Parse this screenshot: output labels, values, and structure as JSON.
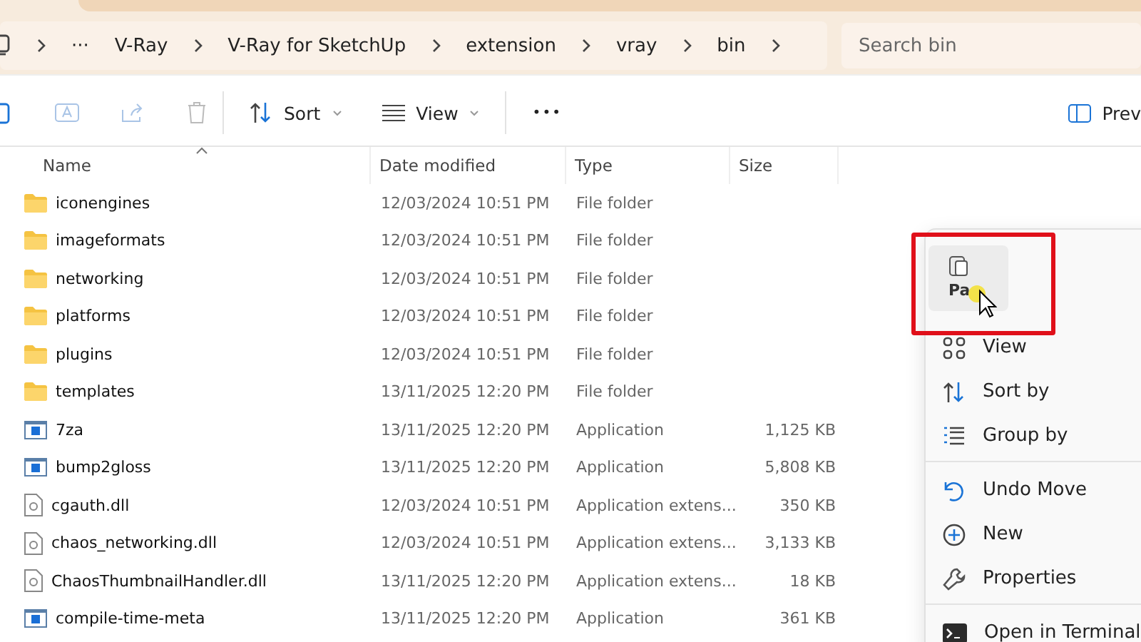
{
  "breadcrumb": {
    "overflow": "···",
    "segments": [
      "V-Ray",
      "V-Ray for SketchUp",
      "extension",
      "vray",
      "bin"
    ]
  },
  "search": {
    "placeholder": "Search bin"
  },
  "toolbar": {
    "sort": "Sort",
    "view": "View",
    "more": "•••",
    "preview": "Prev"
  },
  "columns": [
    "Name",
    "Date modified",
    "Type",
    "Size"
  ],
  "rows": [
    {
      "kind": "folder",
      "name": "iconengines",
      "date": "12/03/2024 10:51 PM",
      "type": "File folder",
      "size": ""
    },
    {
      "kind": "folder",
      "name": "imageformats",
      "date": "12/03/2024 10:51 PM",
      "type": "File folder",
      "size": ""
    },
    {
      "kind": "folder",
      "name": "networking",
      "date": "12/03/2024 10:51 PM",
      "type": "File folder",
      "size": ""
    },
    {
      "kind": "folder",
      "name": "platforms",
      "date": "12/03/2024 10:51 PM",
      "type": "File folder",
      "size": ""
    },
    {
      "kind": "folder",
      "name": "plugins",
      "date": "12/03/2024 10:51 PM",
      "type": "File folder",
      "size": ""
    },
    {
      "kind": "folder",
      "name": "templates",
      "date": "13/11/2025 12:20 PM",
      "type": "File folder",
      "size": ""
    },
    {
      "kind": "app",
      "name": "7za",
      "date": "13/11/2025 12:20 PM",
      "type": "Application",
      "size": "1,125 KB"
    },
    {
      "kind": "app",
      "name": "bump2gloss",
      "date": "13/11/2025 12:20 PM",
      "type": "Application",
      "size": "5,808 KB"
    },
    {
      "kind": "dll",
      "name": "cgauth.dll",
      "date": "12/03/2024 10:51 PM",
      "type": "Application extens...",
      "size": "350 KB"
    },
    {
      "kind": "dll",
      "name": "chaos_networking.dll",
      "date": "12/03/2024 10:51 PM",
      "type": "Application extens...",
      "size": "3,133 KB"
    },
    {
      "kind": "dll",
      "name": "ChaosThumbnailHandler.dll",
      "date": "13/11/2025 12:20 PM",
      "type": "Application extens...",
      "size": "18 KB"
    },
    {
      "kind": "app",
      "name": "compile-time-meta",
      "date": "13/11/2025 12:20 PM",
      "type": "Application",
      "size": "361 KB"
    }
  ],
  "context_menu": {
    "paste": "Pa",
    "sections": [
      [
        {
          "kind": "view",
          "label": "View"
        },
        {
          "kind": "sort",
          "label": "Sort by"
        },
        {
          "kind": "group",
          "label": "Group by"
        }
      ],
      [
        {
          "kind": "undo",
          "label": "Undo Move"
        },
        {
          "kind": "new",
          "label": "New"
        },
        {
          "kind": "properties",
          "label": "Properties"
        }
      ],
      [
        {
          "kind": "terminal",
          "label": "Open in Terminal"
        }
      ]
    ]
  }
}
